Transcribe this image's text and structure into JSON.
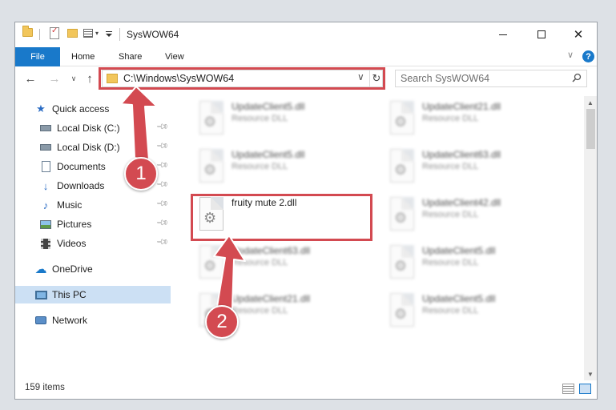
{
  "window": {
    "title": "SysWOW64",
    "controls": {
      "minimize": "minimize",
      "maximize": "maximize",
      "close": "close"
    }
  },
  "ribbon": {
    "tabs": [
      {
        "label": "File"
      },
      {
        "label": "Home"
      },
      {
        "label": "Share"
      },
      {
        "label": "View"
      }
    ],
    "help": "?"
  },
  "nav": {
    "address": "C:\\Windows\\SysWOW64",
    "search_placeholder": "Search SysWOW64"
  },
  "sidebar": {
    "items": [
      {
        "label": "Quick access",
        "icon": "star-icon"
      },
      {
        "label": "Local Disk (C:)",
        "icon": "drive-icon"
      },
      {
        "label": "Local Disk (D:)",
        "icon": "drive-icon"
      },
      {
        "label": "Documents",
        "icon": "document-icon"
      },
      {
        "label": "Downloads",
        "icon": "download-icon"
      },
      {
        "label": "Music",
        "icon": "music-icon"
      },
      {
        "label": "Pictures",
        "icon": "pictures-icon"
      },
      {
        "label": "Videos",
        "icon": "videos-icon"
      },
      {
        "label": "OneDrive",
        "icon": "cloud-icon"
      },
      {
        "label": "This PC",
        "icon": "computer-icon"
      },
      {
        "label": "Network",
        "icon": "network-icon"
      }
    ]
  },
  "files": [
    {
      "name": "UpdateClient5.dll",
      "type": "Resource DLL"
    },
    {
      "name": "UpdateClient21.dll",
      "type": "Resource DLL"
    },
    {
      "name": "UpdateClient5.dll",
      "type": "Resource DLL"
    },
    {
      "name": "UpdateClient63.dll",
      "type": "Resource DLL"
    },
    {
      "name": "fruity mute 2.dll",
      "type": ""
    },
    {
      "name": "UpdateClient42.dll",
      "type": "Resource DLL"
    },
    {
      "name": "UpdateClient63.dll",
      "type": "Resource DLL"
    },
    {
      "name": "UpdateClient5.dll",
      "type": "Resource DLL"
    },
    {
      "name": "UpdateClient21.dll",
      "type": "Resource DLL"
    },
    {
      "name": "UpdateClient5.dll",
      "type": "Resource DLL"
    }
  ],
  "status": {
    "item_count": "159 items"
  },
  "annotations": {
    "step1": "1",
    "step2": "2",
    "color": "#d34a51"
  }
}
